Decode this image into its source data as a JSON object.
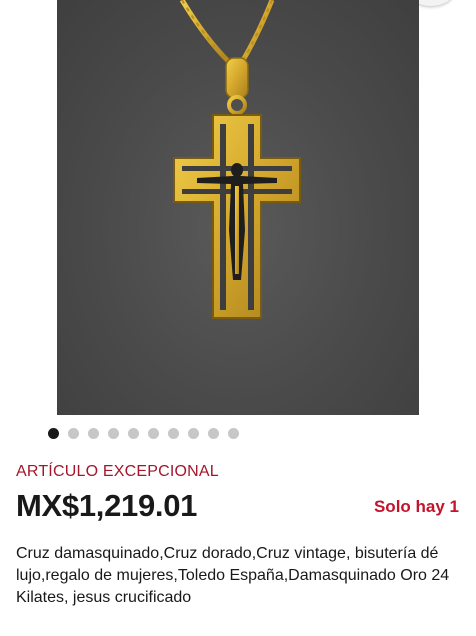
{
  "gallery": {
    "image_alt": "cross pendant necklace",
    "dot_count": 10,
    "active_index": 0
  },
  "listing": {
    "badge": "ARTÍCULO EXCEPCIONAL",
    "price": "MX$1,219.01",
    "stock": "Solo hay 1",
    "title": "Cruz damasquinado,Cruz dorado,Cruz vintage, bisutería dé lujo,regalo de mujeres,Toledo España,Damasquinado Oro 24 Kilates, jesus crucificado"
  },
  "colors": {
    "accent_red": "#a4162b",
    "stock_red": "#c4132a",
    "text": "#191919",
    "photo_bg": "#4a4a4a",
    "gold": "#d4a72c"
  }
}
